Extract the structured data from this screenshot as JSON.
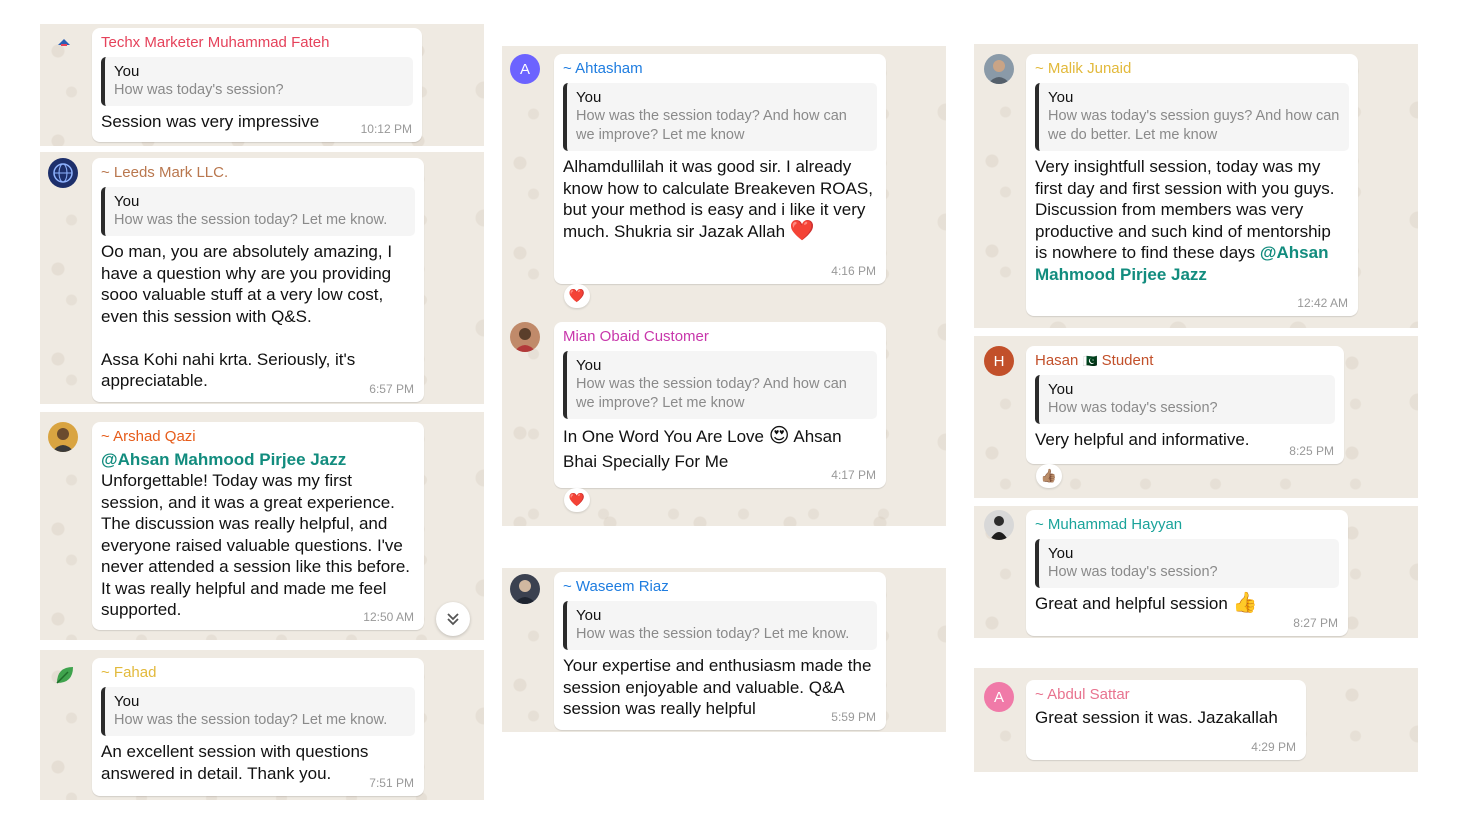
{
  "colors": {
    "red_name": "#e5425b",
    "brown_name": "#b9774e",
    "orange_name": "#e65c1a",
    "yellow_name": "#e2b93b",
    "purple_name": "#6c63ff",
    "magenta_name": "#c837ab",
    "blue_name": "#1f7de0",
    "teal_name": "#1aa39a",
    "pink_name": "#e8738f"
  },
  "chats": [
    {
      "sender": "Techx Marketer Muhammad Fateh",
      "quote_name": "You",
      "quote_text": "How was today's session?",
      "message": "Session was very impressive",
      "time": "10:12 PM",
      "avatar_icon": "logo-icon"
    },
    {
      "sender": "~ Leeds Mark LLC.",
      "quote_name": "You",
      "quote_text": "How was the session today? Let me know.",
      "message": "Oo man, you are absolutely amazing, I have a question why are you providing sooo valuable stuff at a very low cost, even this session with Q&S.\n\nAssa Kohi nahi krta. Seriously, it's appreciatable.",
      "time": "6:57 PM",
      "avatar_icon": "globe-icon"
    },
    {
      "sender": "~ Arshad Qazi",
      "mention": "@Ahsan Mahmood Pirjee Jazz",
      "message": "Unforgettable! Today was my first session, and it was a great experience. The discussion was really helpful, and everyone raised valuable questions. I've never attended a session like this before. It was really helpful and made me feel supported.",
      "time": "12:50 AM",
      "avatar_icon": "user-photo-icon"
    },
    {
      "sender": "~ Fahad",
      "quote_name": "You",
      "quote_text": "How was the session today? Let me know.",
      "message": "An excellent session with questions answered in detail. Thank you.",
      "time": "7:51 PM",
      "avatar_icon": "leaf-icon"
    },
    {
      "sender": "~ Ahtasham",
      "quote_name": "You",
      "quote_text": "How was the session today? And how can we improve? Let me know",
      "message": "Alhamdullilah it was good sir. I already know how to calculate Breakeven ROAS, but your method is easy and i like it very much. Shukria sir Jazak Allah",
      "emoji": "❤️",
      "time": "4:16 PM",
      "reaction": "❤️",
      "avatar_letter": "A"
    },
    {
      "sender": "Mian Obaid Customer",
      "quote_name": "You",
      "quote_text": "How was the session today? And how can we improve? Let me know",
      "message_part1": "In One Word You Are Love",
      "emoji": "😍",
      "message_part2": "Ahsan Bhai Specially For Me",
      "time": "4:17 PM",
      "reaction": "❤️",
      "avatar_icon": "user-photo-icon"
    },
    {
      "sender": "~ Waseem Riaz",
      "quote_name": "You",
      "quote_text": "How was the session today? Let me know.",
      "message": "Your expertise and enthusiasm made the session enjoyable and valuable. Q&A session was really helpful",
      "time": "5:59 PM",
      "avatar_icon": "user-photo-icon"
    },
    {
      "sender": "~ Malik Junaid",
      "quote_name": "You",
      "quote_text": "How was today's session guys? And how can we do better. Let me know",
      "message": "Very insightfull session, today was my first day and first session with you guys. Discussion from members was very productive and such kind of mentorship is nowhere to find these days",
      "mention": "@Ahsan Mahmood Pirjee Jazz",
      "time": "12:42 AM",
      "avatar_icon": "user-photo-icon"
    },
    {
      "sender_part1": "Hasan",
      "flag": "🇵🇰",
      "sender_part2": "Student",
      "quote_name": "You",
      "quote_text": "How was today's session?",
      "message": "Very helpful and informative.",
      "time": "8:25 PM",
      "reaction": "👍🏽",
      "avatar_letter": "H"
    },
    {
      "sender": "~ Muhammad Hayyan",
      "quote_name": "You",
      "quote_text": "How was today's session?",
      "message": "Great and helpful session",
      "emoji": "👍",
      "time": "8:27 PM",
      "avatar_icon": "user-photo-icon"
    },
    {
      "sender": "~ Abdul Sattar",
      "message": "Great session it was. Jazakallah",
      "time": "4:29 PM",
      "avatar_letter": "A"
    }
  ],
  "scroll_icon": "chevron-double-down-icon"
}
